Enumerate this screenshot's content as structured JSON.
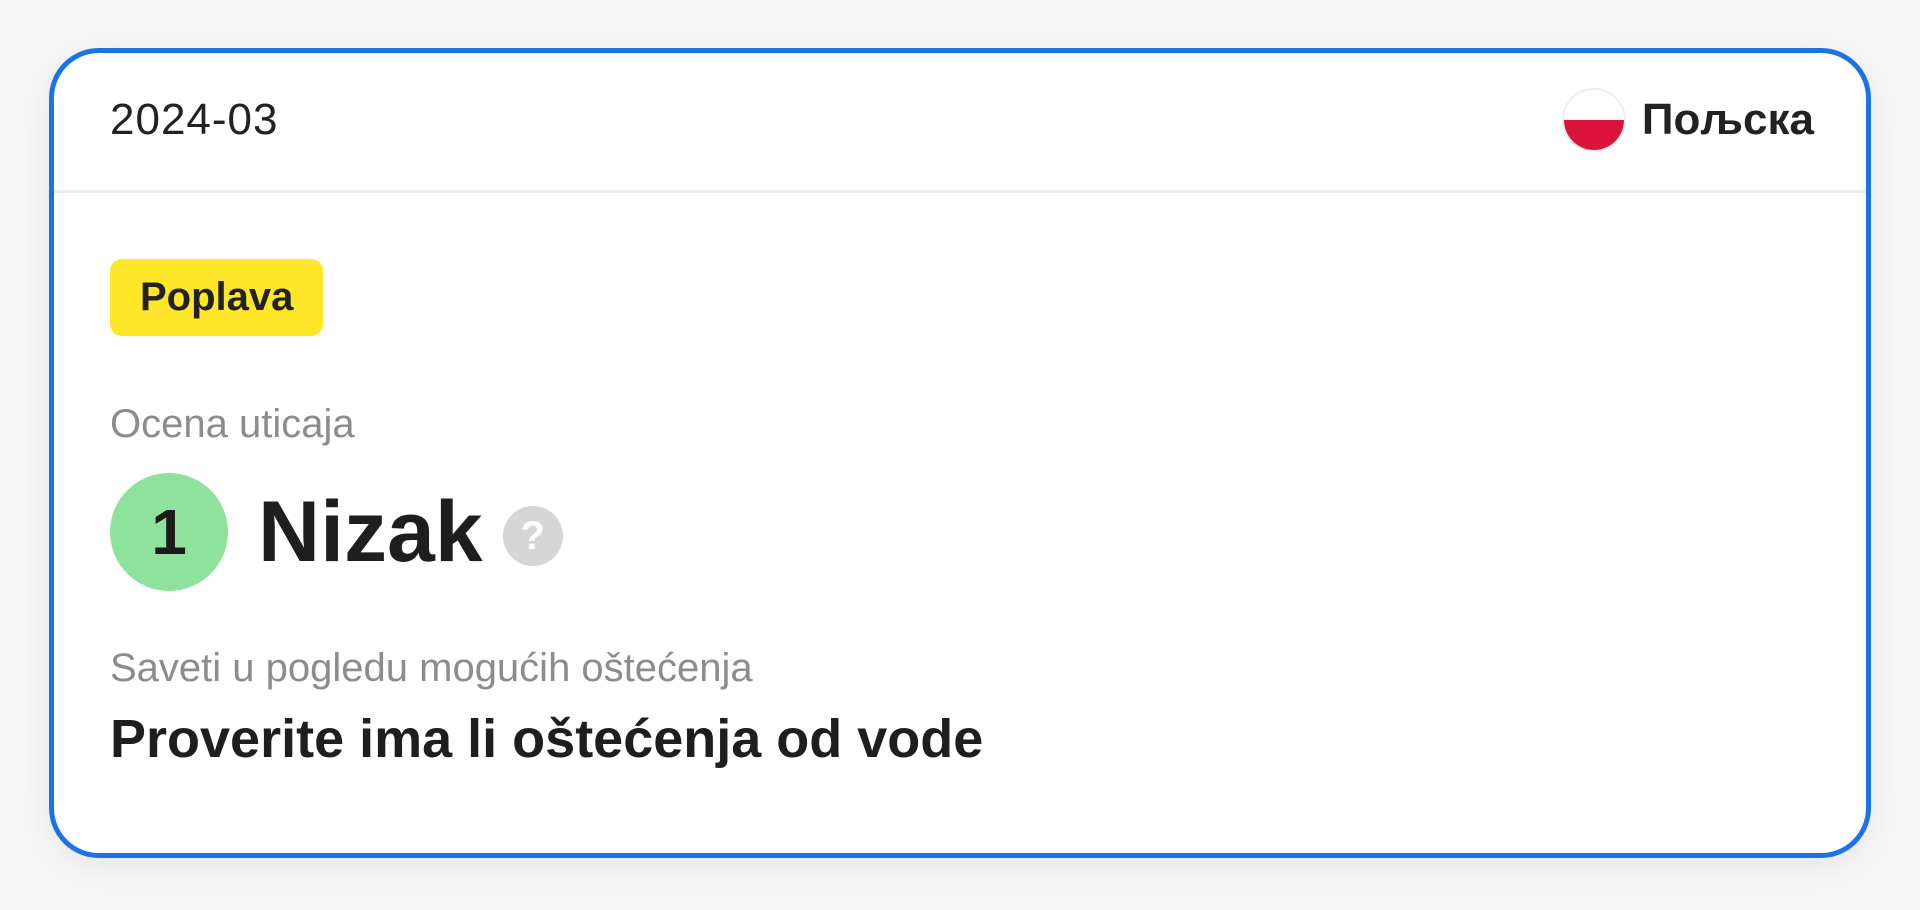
{
  "card": {
    "date": "2024-03",
    "country": {
      "name": "Пољска",
      "flag_icon": "poland-flag-icon",
      "flag_colors": [
        "#ffffff",
        "#dc143c"
      ]
    },
    "event_badge": {
      "label": "Poplava",
      "color": "#ffe629"
    },
    "impact": {
      "label": "Ocena uticaja",
      "score": "1",
      "level": "Nizak",
      "score_color": "#8ee29b",
      "help_icon": "question-mark-icon",
      "help_glyph": "?"
    },
    "advice": {
      "label": "Saveti u pogledu mogućih oštećenja",
      "text": "Proverite ima li oštećenja od vode"
    },
    "accent_color": "#1a73e8"
  }
}
